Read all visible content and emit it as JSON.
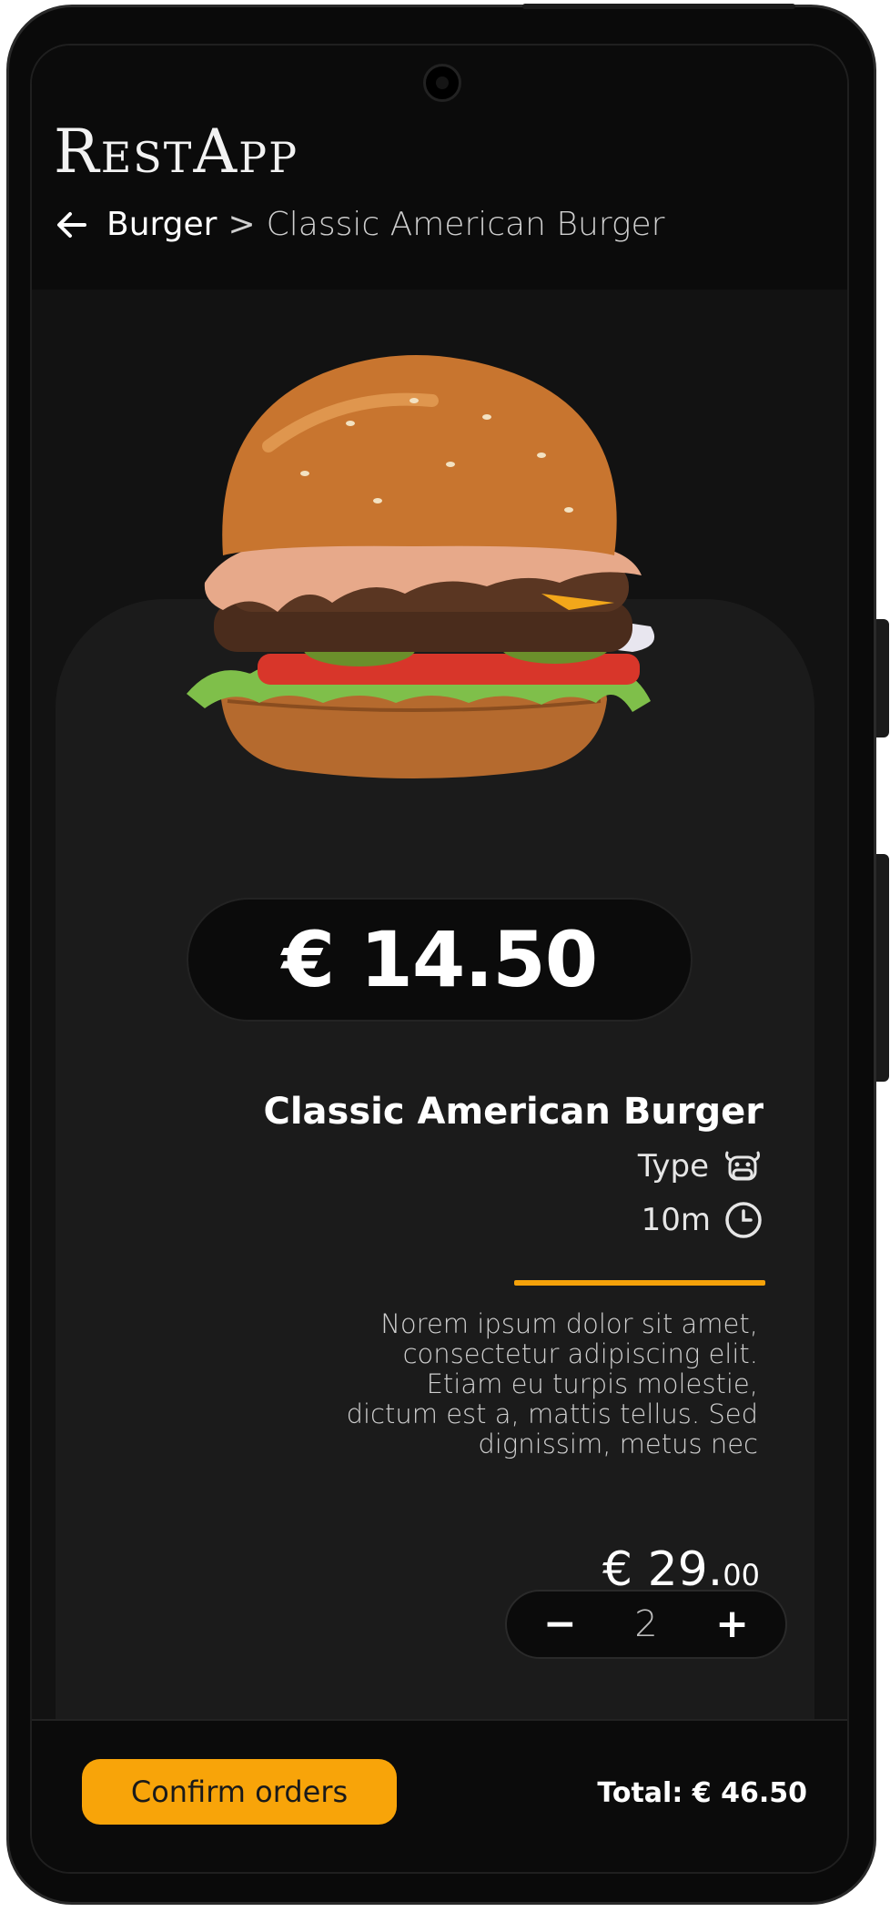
{
  "app": {
    "brand": "RestApp"
  },
  "breadcrumb": {
    "category": "Burger",
    "separator": ">",
    "item": "Classic American Burger"
  },
  "product": {
    "price": "€ 14.50",
    "name": "Classic American Burger",
    "type_label": "Type",
    "time_label": "10m",
    "description": "Norem ipsum dolor sit amet, consectetur adipiscing elit. Etiam eu turpis molestie, dictum est a, mattis tellus. Sed dignissim, metus nec",
    "subtotal_main": "€ 29.",
    "subtotal_cents": "00",
    "quantity": "2",
    "minus": "−",
    "plus": "+"
  },
  "footer": {
    "confirm_label": "Confirm orders",
    "total": "Total: € 46.50"
  },
  "colors": {
    "accent": "#f8a409",
    "background": "#0d0d0d",
    "card": "#1b1b1b"
  },
  "icons": {
    "back": "arrow-left-icon",
    "type": "cow-icon",
    "time": "clock-icon"
  }
}
